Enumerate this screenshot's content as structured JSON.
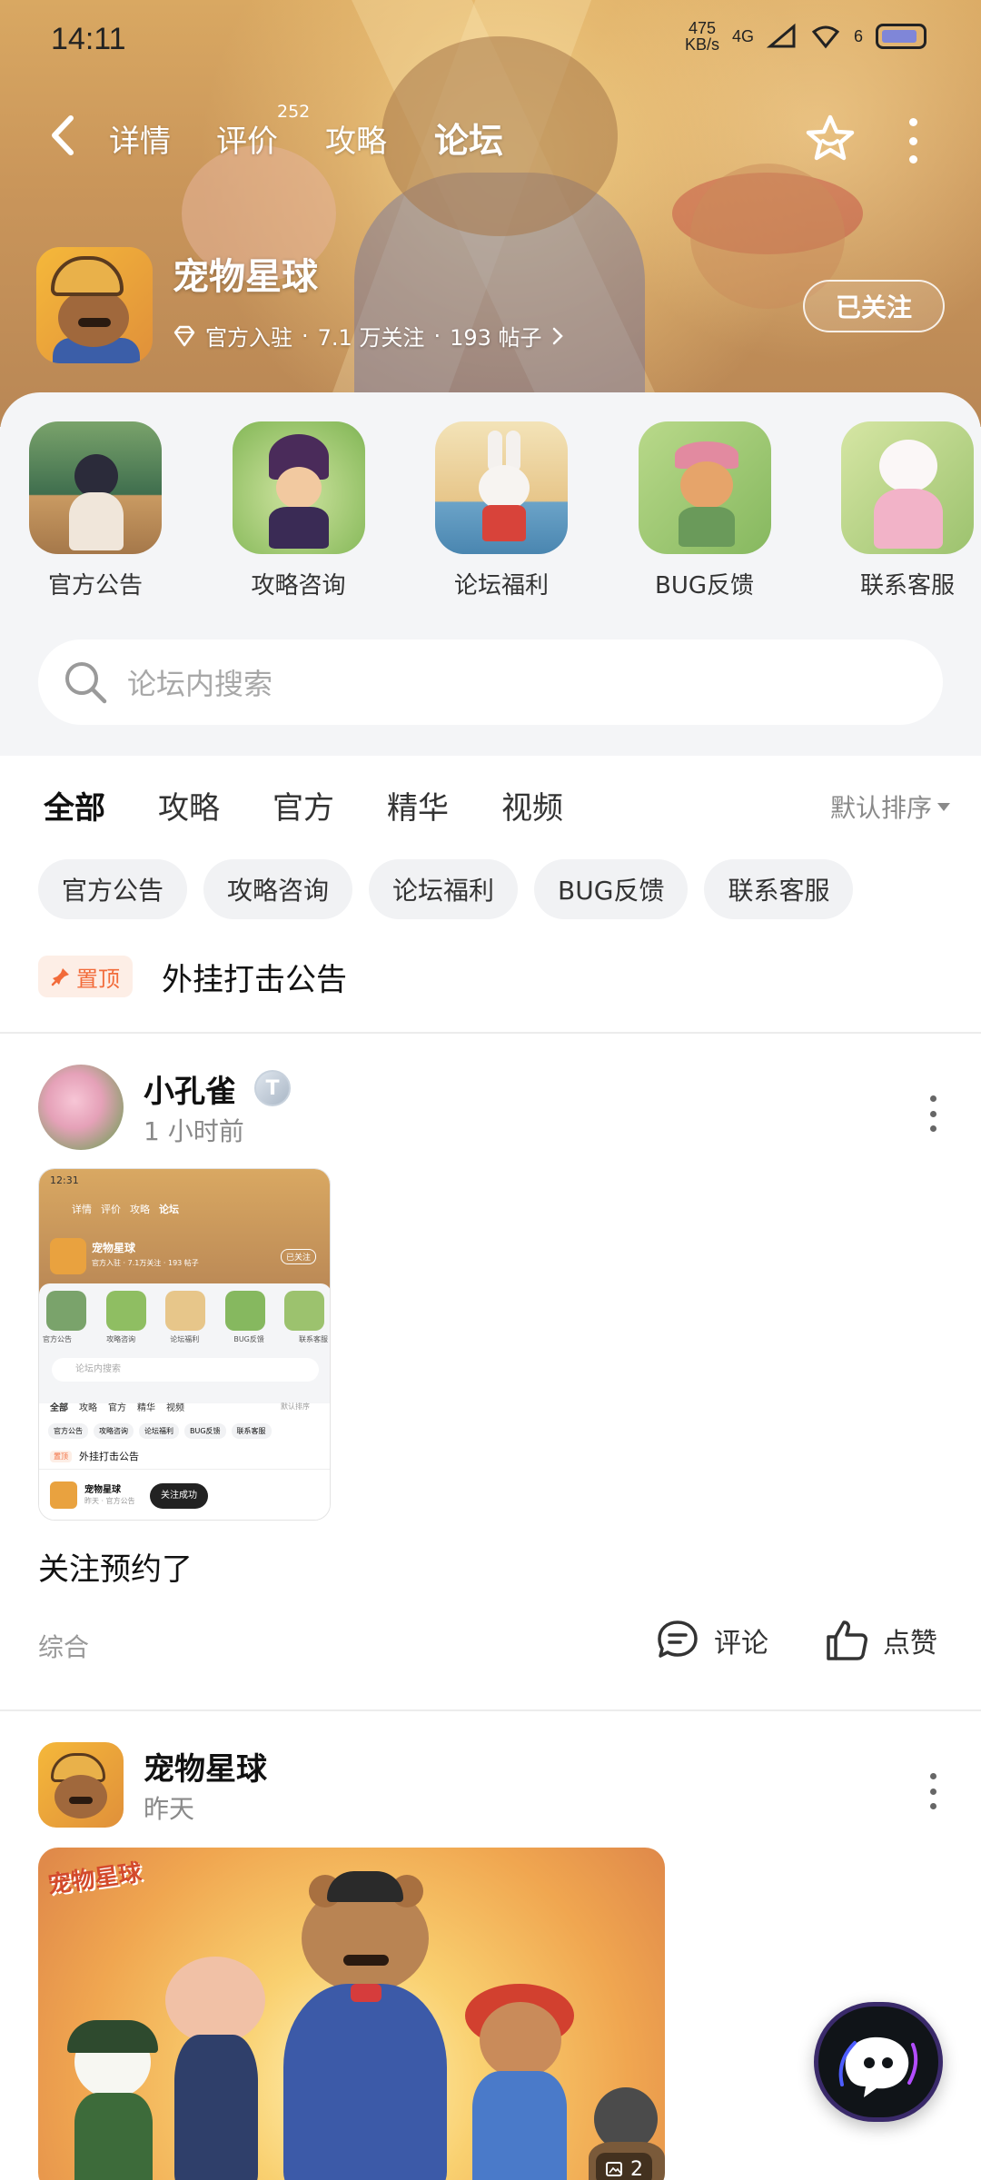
{
  "status_bar": {
    "time": "14:11",
    "net_speed_value": "475",
    "net_speed_unit": "KB/s",
    "network": "4G",
    "signal_sub": "6"
  },
  "nav": {
    "tabs": [
      {
        "label": "详情"
      },
      {
        "label": "评价",
        "badge": "252"
      },
      {
        "label": "攻略"
      },
      {
        "label": "论坛"
      }
    ],
    "active_tab": "论坛",
    "accent_color": "#20d3b1"
  },
  "game": {
    "name": "宠物星球",
    "official": "官方入驻",
    "followers": "7.1 万关注",
    "posts": "193 帖子",
    "follow_label": "已关注"
  },
  "boards": [
    {
      "label": "官方公告"
    },
    {
      "label": "攻略咨询"
    },
    {
      "label": "论坛福利"
    },
    {
      "label": "BUG反馈"
    },
    {
      "label": "联系客服"
    }
  ],
  "search": {
    "placeholder": "论坛内搜索"
  },
  "filter_tabs": [
    {
      "label": "全部"
    },
    {
      "label": "攻略"
    },
    {
      "label": "官方"
    },
    {
      "label": "精华"
    },
    {
      "label": "视频"
    }
  ],
  "sort": {
    "label": "默认排序"
  },
  "chips": [
    {
      "label": "官方公告"
    },
    {
      "label": "攻略咨询"
    },
    {
      "label": "论坛福利"
    },
    {
      "label": "BUG反馈"
    },
    {
      "label": "联系客服"
    }
  ],
  "pinned": {
    "badge": "置顶",
    "title": "外挂打击公告"
  },
  "posts": [
    {
      "author": "小孔雀",
      "level": "T",
      "time": "1 小时前",
      "text": "关注预约了",
      "category": "综合",
      "comment_label": "评论",
      "like_label": "点赞",
      "screenshot": {
        "time": "12:31",
        "tabs": [
          "详情",
          "评价",
          "攻略",
          "论坛"
        ],
        "name": "宠物星球",
        "meta": "官方入驻 · 7.1万关注 · 193 帖子",
        "follow": "已关注",
        "boards": [
          "官方公告",
          "攻略咨询",
          "论坛福利",
          "BUG反馈",
          "联系客服"
        ],
        "search": "论坛内搜索",
        "filters": [
          "全部",
          "攻略",
          "官方",
          "精华",
          "视频"
        ],
        "sort": "默认排序",
        "chips": [
          "官方公告",
          "攻略咨询",
          "论坛福利",
          "BUG反馈",
          "联系客服"
        ],
        "pin_badge": "置顶",
        "pin_title": "外挂打击公告",
        "post_author": "宠物星球",
        "post_time": "昨天 · 官方公告",
        "toast": "关注成功"
      }
    },
    {
      "author": "宠物星球",
      "time": "昨天",
      "image_count": "2",
      "image_logo": "宠物星球"
    }
  ]
}
